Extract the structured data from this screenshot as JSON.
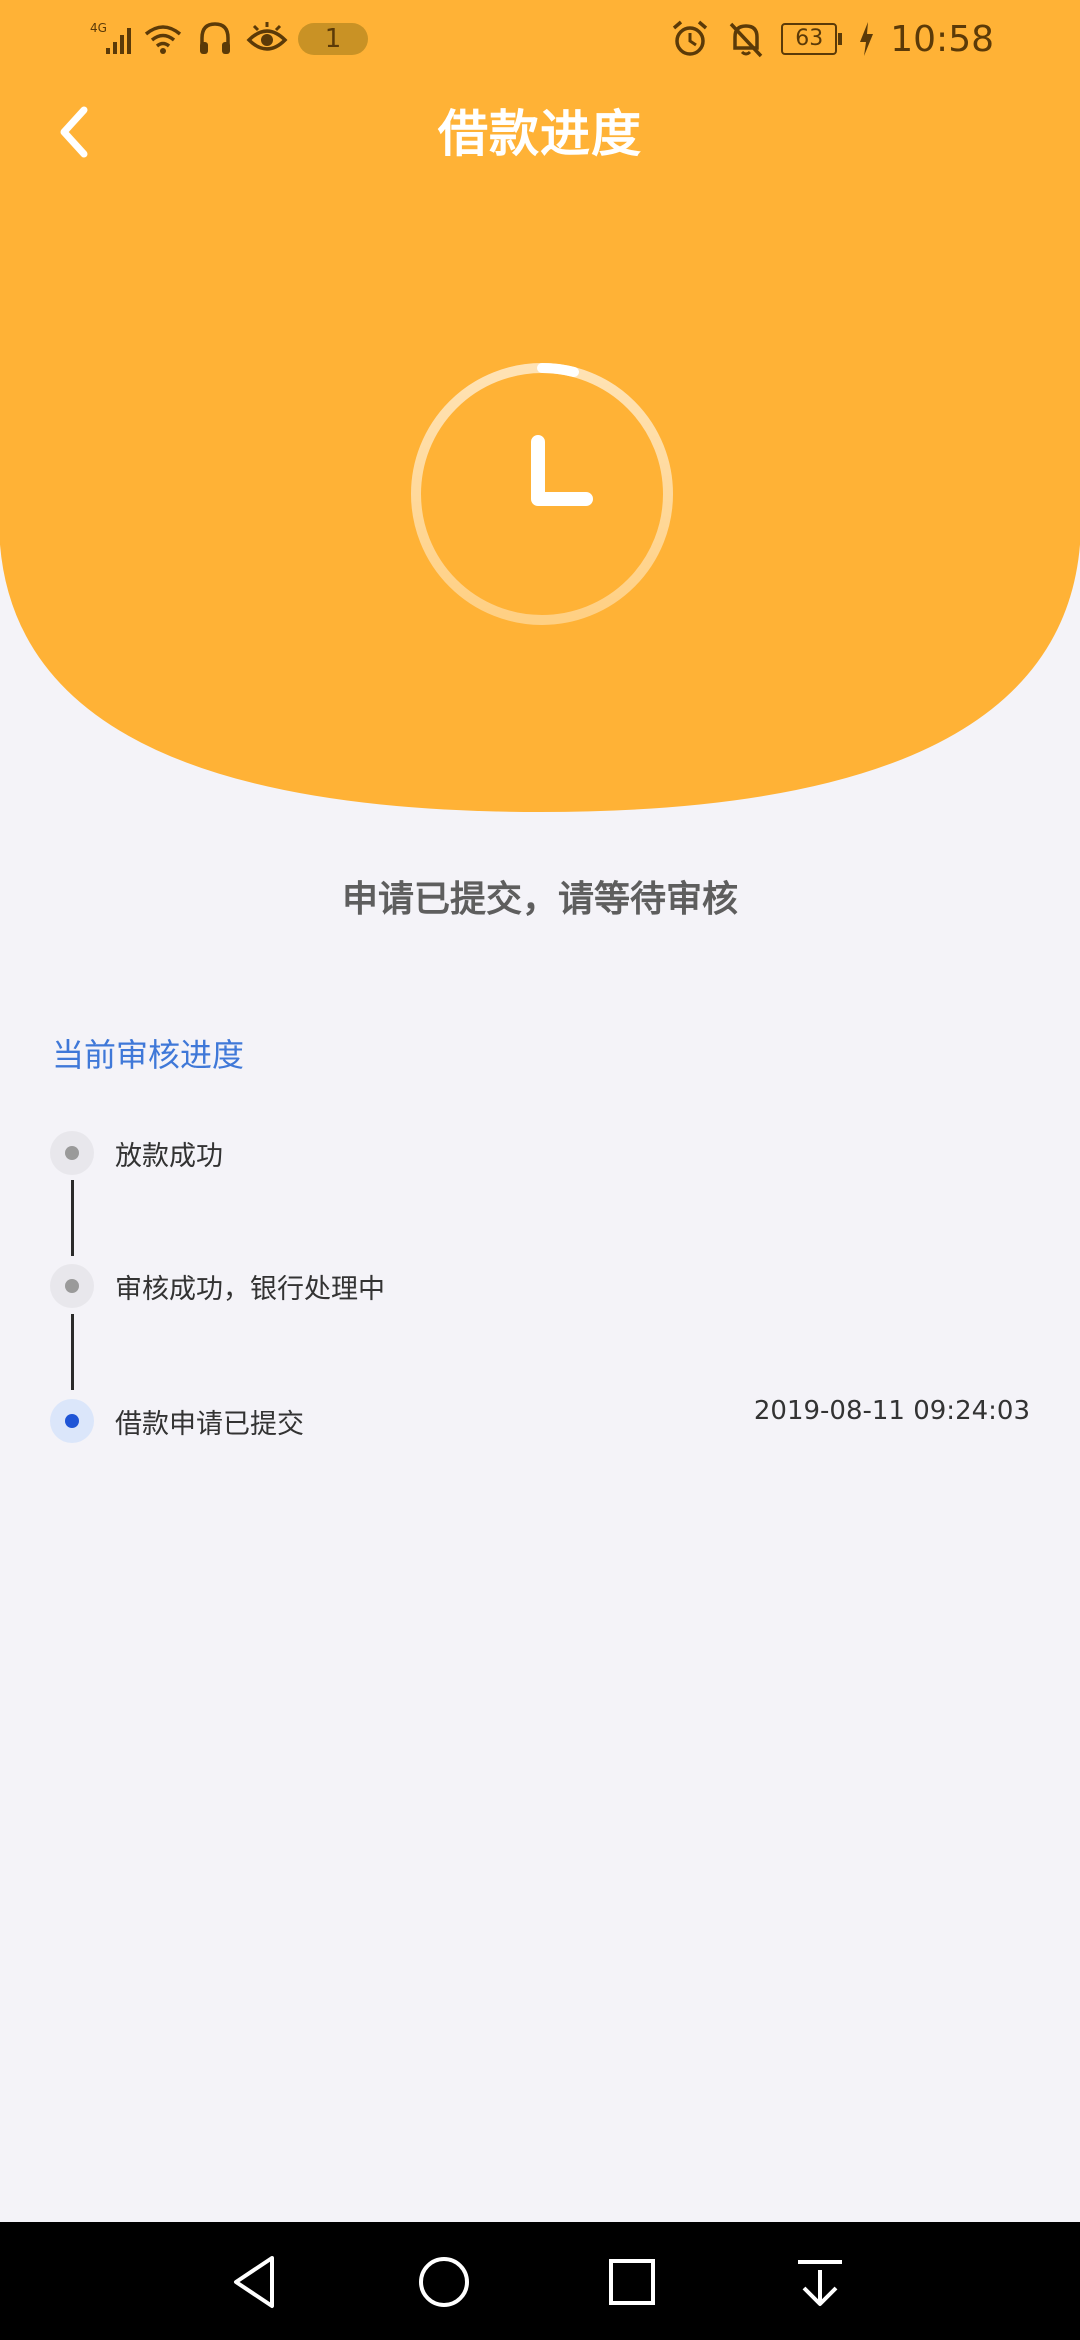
{
  "colors": {
    "header_orange": "#ffb236",
    "accent_blue": "#3f78d8",
    "current_dot": "#1f55d6",
    "background": "#f4f3f8"
  },
  "status_bar": {
    "network_label": "4G",
    "notification_count": "1",
    "battery_level": "63",
    "time": "10:58",
    "icons": [
      "signal-icon",
      "wifi-icon",
      "headset-icon",
      "eye-icon",
      "alarm-icon",
      "mute-bell-icon",
      "battery-icon",
      "charging-icon"
    ]
  },
  "header": {
    "title": "借款进度",
    "back_icon": "chevron-left-icon",
    "status_icon": "clock-icon"
  },
  "status_message": "申请已提交，请等待审核",
  "progress": {
    "section_title": "当前审核进度",
    "steps": [
      {
        "label": "放款成功",
        "state": "pending",
        "time": ""
      },
      {
        "label": "审核成功，银行处理中",
        "state": "pending",
        "time": ""
      },
      {
        "label": "借款申请已提交",
        "state": "current",
        "time": "2019-08-11 09:24:03"
      }
    ]
  },
  "system_nav": {
    "buttons": [
      "back-triangle-icon",
      "home-circle-icon",
      "recents-square-icon",
      "notification-pulldown-icon"
    ]
  }
}
